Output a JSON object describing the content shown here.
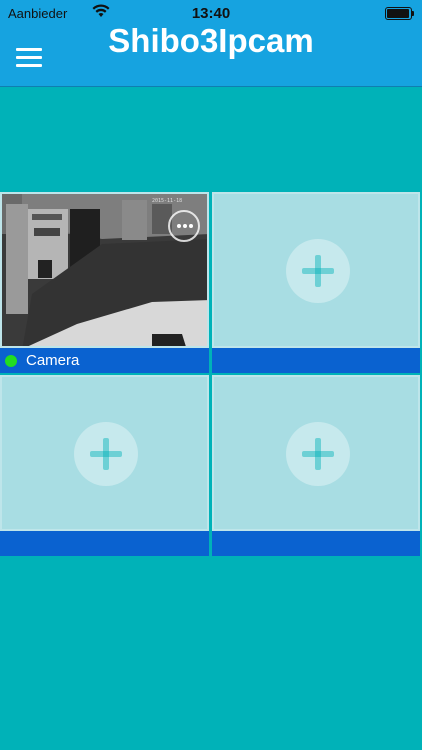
{
  "status_bar": {
    "carrier": "Aanbieder",
    "time": "13:40"
  },
  "header": {
    "title": "Shibo3Ipcam"
  },
  "grid": {
    "camera": {
      "label": "Camera",
      "status_color": "#22dd22"
    }
  },
  "colors": {
    "background": "#00b2b8",
    "header": "#16a3e0",
    "tile_bar": "#0a62d0"
  }
}
